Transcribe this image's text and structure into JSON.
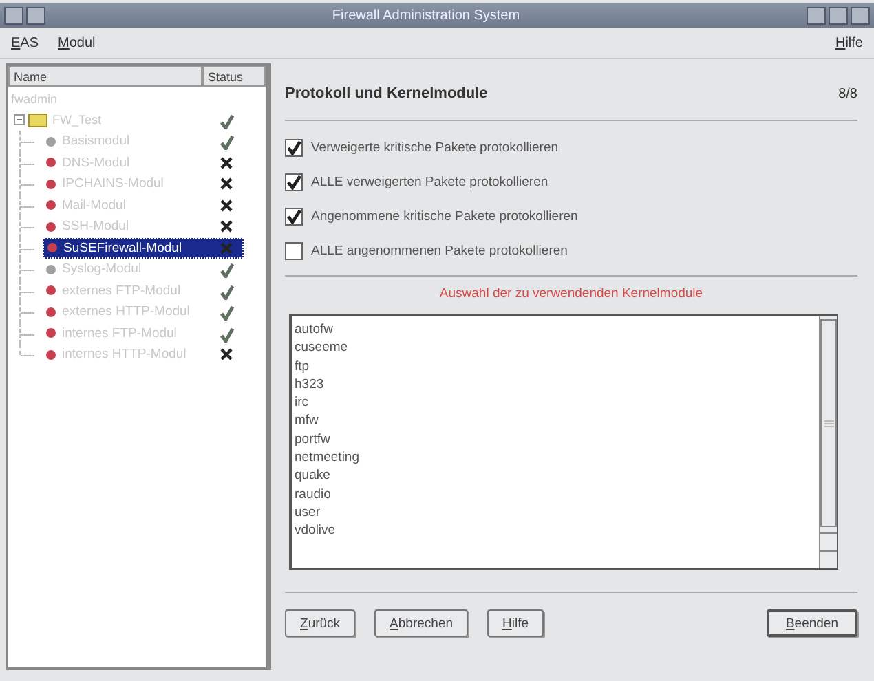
{
  "window": {
    "title": "Firewall Administration System"
  },
  "menu": [
    {
      "label": "EAS"
    },
    {
      "label": "Modul"
    }
  ],
  "help_menu": {
    "label": "Hilfe"
  },
  "tree": {
    "columns": [
      "Name",
      "Status"
    ],
    "root": "fwadmin",
    "folder": {
      "label": "FW_Test",
      "passed": true,
      "children": [
        {
          "label": "Basismodul",
          "color": "#a0a0a0",
          "passed": true,
          "selected": false
        },
        {
          "label": "DNS-Modul",
          "color": "#c84050",
          "passed": false,
          "selected": false
        },
        {
          "label": "IPCHAINS-Modul",
          "color": "#c84050",
          "passed": false,
          "selected": false
        },
        {
          "label": "Mail-Modul",
          "color": "#c84050",
          "passed": false,
          "selected": false
        },
        {
          "label": "SSH-Modul",
          "color": "#c84050",
          "passed": false,
          "selected": false
        },
        {
          "label": "SuSEFirewall-Modul",
          "color": "#c84050",
          "passed": false,
          "selected": true
        },
        {
          "label": "Syslog-Modul",
          "color": "#a0a0a0",
          "passed": true,
          "selected": false
        },
        {
          "label": "externes FTP-Modul",
          "color": "#c84050",
          "passed": true,
          "selected": false
        },
        {
          "label": "externes HTTP-Modul",
          "color": "#c84050",
          "passed": true,
          "selected": false
        },
        {
          "label": "internes FTP-Modul",
          "color": "#c84050",
          "passed": true,
          "selected": false
        },
        {
          "label": "internes HTTP-Modul",
          "color": "#c84050",
          "passed": false,
          "selected": false
        }
      ]
    }
  },
  "page": {
    "title": "Protokoll und Kernelmodule",
    "counter": "8/8",
    "options": [
      {
        "label": "Verweigerte kritische Pakete protokollieren",
        "checked": true
      },
      {
        "label": "ALLE verweigerten Pakete protokollieren",
        "checked": true
      },
      {
        "label": "Angenommene kritische Pakete protokollieren",
        "checked": true
      },
      {
        "label": "ALLE angenommenen Pakete protokollieren",
        "checked": false
      }
    ],
    "modules_heading": "Auswahl der zu verwendenden Kernelmodule",
    "modules": [
      "autofw",
      "cuseeme",
      "ftp",
      "h323",
      "irc",
      "mfw",
      "portfw",
      "netmeeting",
      "quake",
      "raudio",
      "user",
      "vdolive"
    ]
  },
  "buttons": [
    {
      "label": "Zurück",
      "default": false
    },
    {
      "label": "Abbrechen",
      "default": false
    },
    {
      "label": "Hilfe",
      "default": false
    },
    {
      "label": "Beenden",
      "default": true
    }
  ]
}
